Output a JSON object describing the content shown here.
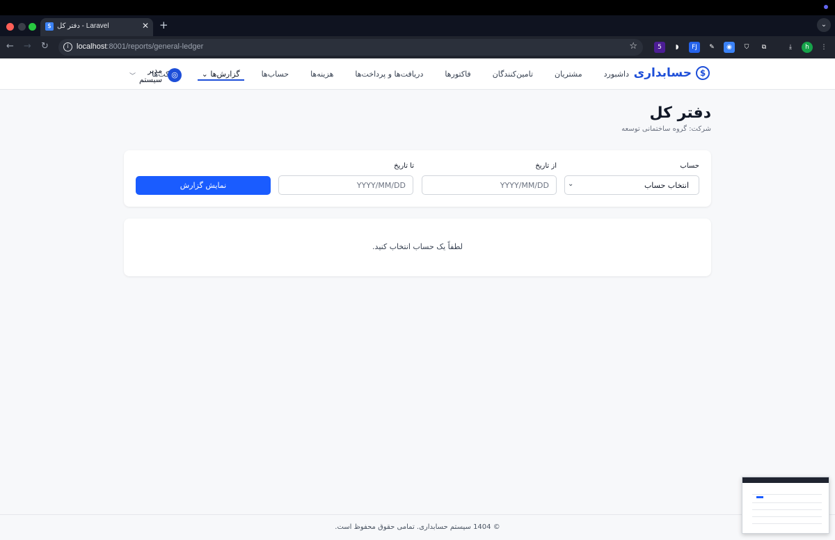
{
  "browser": {
    "tab_title": "دفتر کل - Laravel",
    "tab_favicon": "$",
    "url_host": "localhost",
    "url_path": ":8001/reports/general-ledger",
    "extensions": [
      {
        "icon": "extension-badge-icon",
        "label": "5",
        "color": "#4c1d95"
      },
      {
        "icon": "extension-orange-icon",
        "label": "◗",
        "color": "#20242e"
      },
      {
        "icon": "extension-fj-icon",
        "label": "FJ",
        "color": "#2563eb"
      },
      {
        "icon": "extension-pen-icon",
        "label": "✎",
        "color": "#20242e"
      },
      {
        "icon": "extension-camera-icon",
        "label": "◉",
        "color": "#3b82f6"
      },
      {
        "icon": "extension-shield-icon",
        "label": "⛉",
        "color": "#20242e"
      },
      {
        "icon": "extension-puzzle-icon",
        "label": "⧉",
        "color": "#20242e"
      }
    ],
    "profile_initial": "h"
  },
  "app": {
    "brand": "حسابداری",
    "brand_icon": "$",
    "menu": [
      {
        "id": "dashboard",
        "label": "داشبورد",
        "active": false
      },
      {
        "id": "customers",
        "label": "مشتریان",
        "active": false
      },
      {
        "id": "suppliers",
        "label": "تامین‌کنندگان",
        "active": false
      },
      {
        "id": "invoices",
        "label": "فاکتورها",
        "active": false
      },
      {
        "id": "payments",
        "label": "دریافت‌ها و پرداخت‌ها",
        "active": false
      },
      {
        "id": "expenses",
        "label": "هزینه‌ها",
        "active": false
      },
      {
        "id": "accounts",
        "label": "حساب‌ها",
        "active": false
      },
      {
        "id": "reports",
        "label": "گزارش‌ها",
        "active": true
      },
      {
        "id": "companies",
        "label": "شرکت‌ها",
        "active": false
      }
    ],
    "user_name": "مدیر سیستم"
  },
  "page": {
    "title": "دفتر کل",
    "company": "شرکت: گروه ساختمانی توسعه",
    "filters": {
      "account_label": "حساب",
      "account_value": "انتخاب حساب",
      "from_label": "از تاریخ",
      "from_placeholder": "YYYY/MM/DD",
      "to_label": "تا تاریخ",
      "to_placeholder": "YYYY/MM/DD",
      "submit_label": "نمایش گزارش"
    },
    "empty_message": "لطفاً یک حساب انتخاب کنید."
  },
  "footer": {
    "text": "© 1404 سیستم حسابداری. تمامی حقوق محفوظ است."
  },
  "colors": {
    "accent": "#1d4ed8",
    "button": "#1a5cff"
  }
}
